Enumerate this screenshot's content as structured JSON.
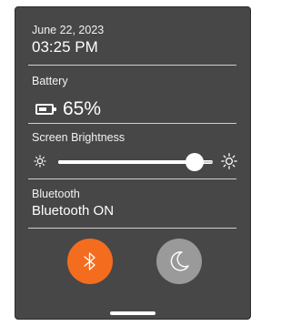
{
  "status": {
    "date": "June 22, 2023",
    "time": "03:25 PM"
  },
  "battery": {
    "label": "Battery",
    "percent_text": "65%",
    "level": 0.65
  },
  "brightness": {
    "label": "Screen Brightness",
    "level": 0.88
  },
  "bluetooth": {
    "label": "Bluetooth",
    "value": "Bluetooth ON"
  },
  "controls": {
    "bluetooth_button_icon": "bluetooth-icon",
    "night_mode_button_icon": "moon-icon"
  },
  "colors": {
    "panel": "#474747",
    "accent": "#f46d1f",
    "inactive_button": "#9a9a9a"
  }
}
